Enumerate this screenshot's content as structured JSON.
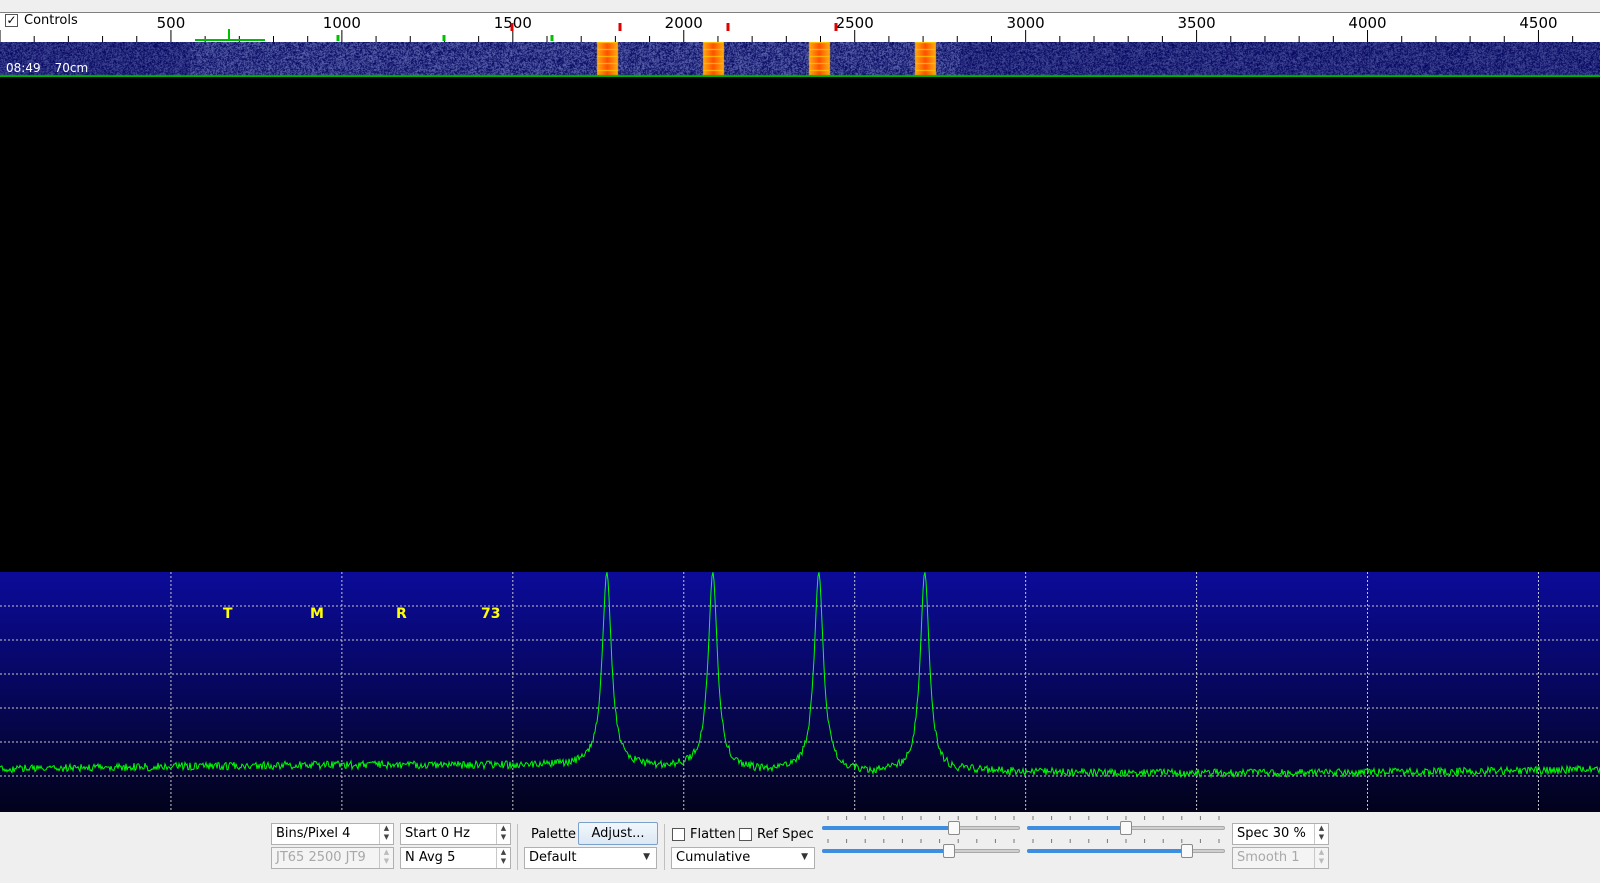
{
  "window": {
    "controls_label": "Controls",
    "controls_checked": true
  },
  "scale": {
    "labels": [
      "500",
      "1000",
      "1500",
      "2000",
      "2500",
      "3000",
      "3500",
      "4000",
      "4500"
    ],
    "freq_min": 0,
    "freq_max": 4680
  },
  "waterfall": {
    "time": "08:49",
    "band": "70cm",
    "signal_freqs": [
      1775,
      2085,
      2395,
      2705
    ]
  },
  "spectrum": {
    "tone_labels": [
      "T",
      "M",
      "R",
      "73"
    ],
    "peak_freqs": [
      1775,
      2085,
      2395,
      2705
    ],
    "bg_top_color": "#0b0b9a",
    "bg_bottom_color": "#02021c",
    "trace_color": "#00ff00"
  },
  "controls": {
    "bins_pixel_label": "Bins/Pixel  4",
    "start_label": "Start 0 Hz",
    "mode_label": "JT65  2500  JT9",
    "navg_label": "N Avg 5",
    "palette_label": "Palette",
    "adjust_button": "Adjust...",
    "palette_value": "Default",
    "flatten_label": "Flatten",
    "refspec_label": "Ref Spec",
    "spectrum_type": "Cumulative",
    "spec_label": "Spec 30 %",
    "smooth_label": "Smooth  1",
    "slider1_level": 0.68,
    "slider2_level": 0.5,
    "slider3_level": 0.65,
    "slider4_level": 0.83
  }
}
